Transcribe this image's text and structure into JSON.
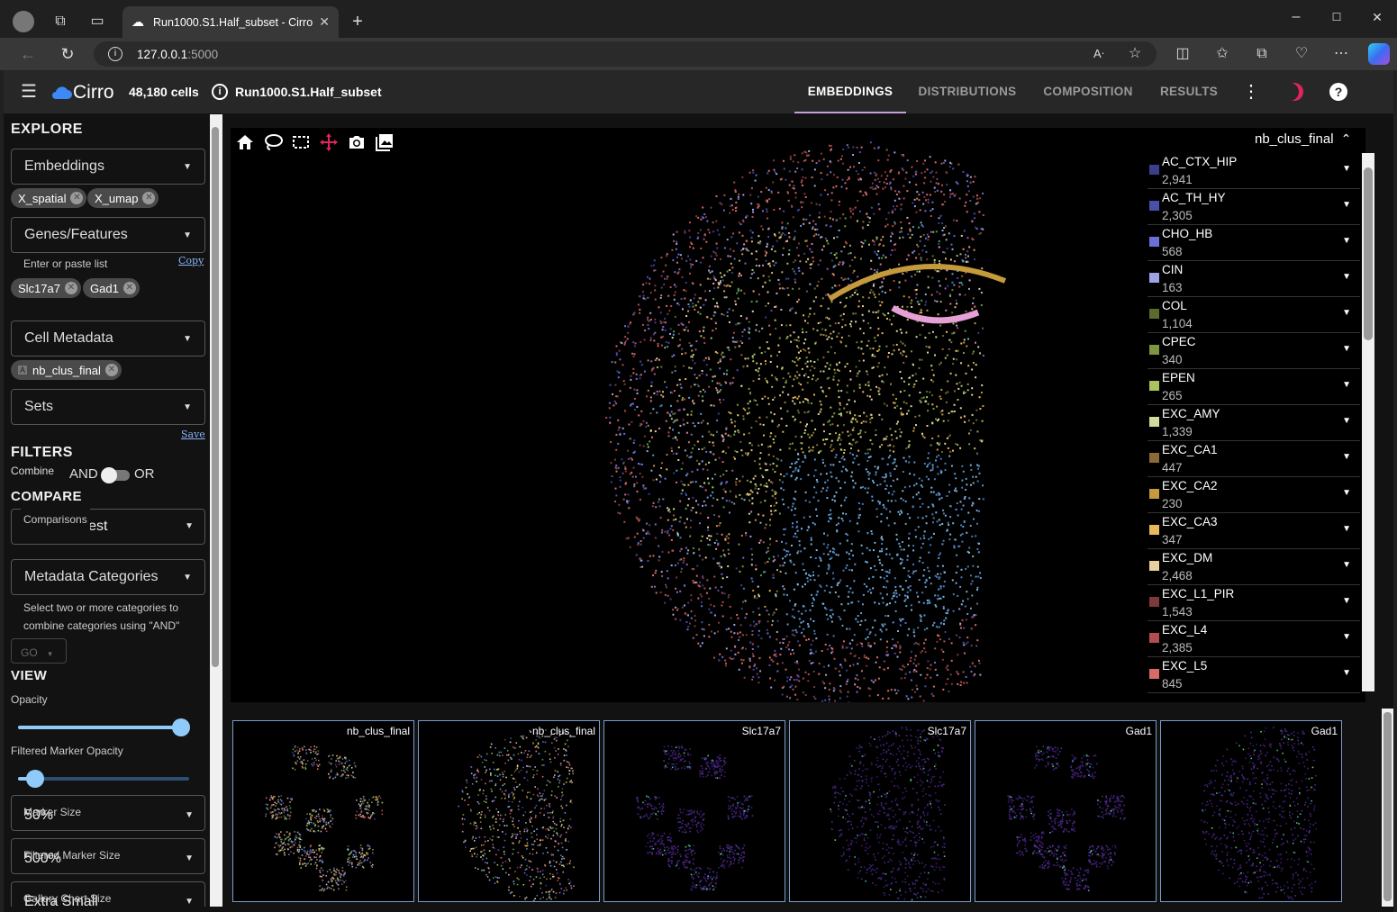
{
  "browser": {
    "tab_title": "Run1000.S1.Half_subset - Cirro",
    "url_host": "127.0.0.1",
    "url_port": ":5000"
  },
  "app": {
    "brand": "Cirro",
    "cell_count": "48,180 cells",
    "dataset": "Run1000.S1.Half_subset",
    "tabs": [
      {
        "label": "EMBEDDINGS",
        "active": true
      },
      {
        "label": "DISTRIBUTIONS"
      },
      {
        "label": "COMPOSITION"
      },
      {
        "label": "RESULTS"
      }
    ]
  },
  "sidebar": {
    "explore_heading": "EXPLORE",
    "embeddings_label": "Embeddings",
    "embedding_chips": [
      "X_spatial",
      "X_umap"
    ],
    "genes_label": "Genes/Features",
    "genes_hint": "Enter or paste list",
    "copy_link": "Copy",
    "gene_chips": [
      "Slc17a7",
      "Gad1"
    ],
    "metadata_label": "Cell Metadata",
    "metadata_chip": "nb_clus_final",
    "sets_label": "Sets",
    "save_link": "Save",
    "filters_heading": "FILTERS",
    "combine_label": "Combine",
    "and_label": "AND",
    "or_label": "OR",
    "compare_heading": "COMPARE",
    "comparisons_label": "Comparisons",
    "comparisons_value": "One vs. Rest",
    "metadata_categories_label": "Metadata Categories",
    "metadata_categories_hint": "Select two or more categories to combine categories using \"AND\"",
    "go_label": "GO",
    "view_heading": "VIEW",
    "opacity_label": "Opacity",
    "opacity_value": 0.95,
    "filtered_opacity_label": "Filtered Marker Opacity",
    "filtered_opacity_value": 0.1,
    "marker_size_label": "Marker Size",
    "marker_size_value": "50%",
    "filtered_marker_size_label": "Filtered Marker Size",
    "filtered_marker_size_value": "500%",
    "gallery_size_label": "Gallery Chart Size",
    "gallery_size_value": "Extra Small"
  },
  "legend": {
    "title": "nb_clus_final",
    "items": [
      {
        "name": "AC_CTX_HIP",
        "count": "2,941",
        "color": "#3a3f8c"
      },
      {
        "name": "AC_TH_HY",
        "count": "2,305",
        "color": "#4a4fa8"
      },
      {
        "name": "CHO_HB",
        "count": "568",
        "color": "#6b6fd6"
      },
      {
        "name": "CIN",
        "count": "163",
        "color": "#9ea3e6"
      },
      {
        "name": "COL",
        "count": "1,104",
        "color": "#5a6b2e"
      },
      {
        "name": "CPEC",
        "count": "340",
        "color": "#7d9440"
      },
      {
        "name": "EPEN",
        "count": "265",
        "color": "#a9c45e"
      },
      {
        "name": "EXC_AMY",
        "count": "1,339",
        "color": "#cfdc9b"
      },
      {
        "name": "EXC_CA1",
        "count": "447",
        "color": "#8a6b38"
      },
      {
        "name": "EXC_CA2",
        "count": "230",
        "color": "#c49a3c"
      },
      {
        "name": "EXC_CA3",
        "count": "347",
        "color": "#e8b95a"
      },
      {
        "name": "EXC_DM",
        "count": "2,468",
        "color": "#e9d0a0"
      },
      {
        "name": "EXC_L1_PIR",
        "count": "1,543",
        "color": "#7e3a3a"
      },
      {
        "name": "EXC_L4",
        "count": "2,385",
        "color": "#b44e4e"
      },
      {
        "name": "EXC_L5",
        "count": "845",
        "color": "#d96a6a"
      }
    ]
  },
  "gallery": [
    {
      "label": "nb_clus_final"
    },
    {
      "label": "nb_clus_final"
    },
    {
      "label": "Slc17a7"
    },
    {
      "label": "Slc17a7"
    },
    {
      "label": "Gad1"
    },
    {
      "label": "Gad1"
    }
  ]
}
